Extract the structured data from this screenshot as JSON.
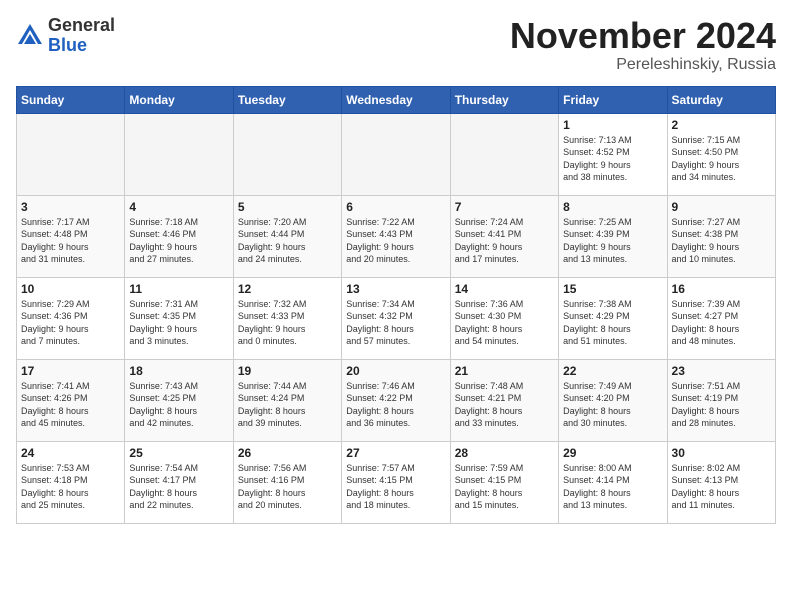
{
  "logo": {
    "general": "General",
    "blue": "Blue"
  },
  "header": {
    "month": "November 2024",
    "location": "Pereleshinskiy, Russia"
  },
  "weekdays": [
    "Sunday",
    "Monday",
    "Tuesday",
    "Wednesday",
    "Thursday",
    "Friday",
    "Saturday"
  ],
  "weeks": [
    [
      {
        "day": "",
        "info": ""
      },
      {
        "day": "",
        "info": ""
      },
      {
        "day": "",
        "info": ""
      },
      {
        "day": "",
        "info": ""
      },
      {
        "day": "",
        "info": ""
      },
      {
        "day": "1",
        "info": "Sunrise: 7:13 AM\nSunset: 4:52 PM\nDaylight: 9 hours\nand 38 minutes."
      },
      {
        "day": "2",
        "info": "Sunrise: 7:15 AM\nSunset: 4:50 PM\nDaylight: 9 hours\nand 34 minutes."
      }
    ],
    [
      {
        "day": "3",
        "info": "Sunrise: 7:17 AM\nSunset: 4:48 PM\nDaylight: 9 hours\nand 31 minutes."
      },
      {
        "day": "4",
        "info": "Sunrise: 7:18 AM\nSunset: 4:46 PM\nDaylight: 9 hours\nand 27 minutes."
      },
      {
        "day": "5",
        "info": "Sunrise: 7:20 AM\nSunset: 4:44 PM\nDaylight: 9 hours\nand 24 minutes."
      },
      {
        "day": "6",
        "info": "Sunrise: 7:22 AM\nSunset: 4:43 PM\nDaylight: 9 hours\nand 20 minutes."
      },
      {
        "day": "7",
        "info": "Sunrise: 7:24 AM\nSunset: 4:41 PM\nDaylight: 9 hours\nand 17 minutes."
      },
      {
        "day": "8",
        "info": "Sunrise: 7:25 AM\nSunset: 4:39 PM\nDaylight: 9 hours\nand 13 minutes."
      },
      {
        "day": "9",
        "info": "Sunrise: 7:27 AM\nSunset: 4:38 PM\nDaylight: 9 hours\nand 10 minutes."
      }
    ],
    [
      {
        "day": "10",
        "info": "Sunrise: 7:29 AM\nSunset: 4:36 PM\nDaylight: 9 hours\nand 7 minutes."
      },
      {
        "day": "11",
        "info": "Sunrise: 7:31 AM\nSunset: 4:35 PM\nDaylight: 9 hours\nand 3 minutes."
      },
      {
        "day": "12",
        "info": "Sunrise: 7:32 AM\nSunset: 4:33 PM\nDaylight: 9 hours\nand 0 minutes."
      },
      {
        "day": "13",
        "info": "Sunrise: 7:34 AM\nSunset: 4:32 PM\nDaylight: 8 hours\nand 57 minutes."
      },
      {
        "day": "14",
        "info": "Sunrise: 7:36 AM\nSunset: 4:30 PM\nDaylight: 8 hours\nand 54 minutes."
      },
      {
        "day": "15",
        "info": "Sunrise: 7:38 AM\nSunset: 4:29 PM\nDaylight: 8 hours\nand 51 minutes."
      },
      {
        "day": "16",
        "info": "Sunrise: 7:39 AM\nSunset: 4:27 PM\nDaylight: 8 hours\nand 48 minutes."
      }
    ],
    [
      {
        "day": "17",
        "info": "Sunrise: 7:41 AM\nSunset: 4:26 PM\nDaylight: 8 hours\nand 45 minutes."
      },
      {
        "day": "18",
        "info": "Sunrise: 7:43 AM\nSunset: 4:25 PM\nDaylight: 8 hours\nand 42 minutes."
      },
      {
        "day": "19",
        "info": "Sunrise: 7:44 AM\nSunset: 4:24 PM\nDaylight: 8 hours\nand 39 minutes."
      },
      {
        "day": "20",
        "info": "Sunrise: 7:46 AM\nSunset: 4:22 PM\nDaylight: 8 hours\nand 36 minutes."
      },
      {
        "day": "21",
        "info": "Sunrise: 7:48 AM\nSunset: 4:21 PM\nDaylight: 8 hours\nand 33 minutes."
      },
      {
        "day": "22",
        "info": "Sunrise: 7:49 AM\nSunset: 4:20 PM\nDaylight: 8 hours\nand 30 minutes."
      },
      {
        "day": "23",
        "info": "Sunrise: 7:51 AM\nSunset: 4:19 PM\nDaylight: 8 hours\nand 28 minutes."
      }
    ],
    [
      {
        "day": "24",
        "info": "Sunrise: 7:53 AM\nSunset: 4:18 PM\nDaylight: 8 hours\nand 25 minutes."
      },
      {
        "day": "25",
        "info": "Sunrise: 7:54 AM\nSunset: 4:17 PM\nDaylight: 8 hours\nand 22 minutes."
      },
      {
        "day": "26",
        "info": "Sunrise: 7:56 AM\nSunset: 4:16 PM\nDaylight: 8 hours\nand 20 minutes."
      },
      {
        "day": "27",
        "info": "Sunrise: 7:57 AM\nSunset: 4:15 PM\nDaylight: 8 hours\nand 18 minutes."
      },
      {
        "day": "28",
        "info": "Sunrise: 7:59 AM\nSunset: 4:15 PM\nDaylight: 8 hours\nand 15 minutes."
      },
      {
        "day": "29",
        "info": "Sunrise: 8:00 AM\nSunset: 4:14 PM\nDaylight: 8 hours\nand 13 minutes."
      },
      {
        "day": "30",
        "info": "Sunrise: 8:02 AM\nSunset: 4:13 PM\nDaylight: 8 hours\nand 11 minutes."
      }
    ]
  ]
}
